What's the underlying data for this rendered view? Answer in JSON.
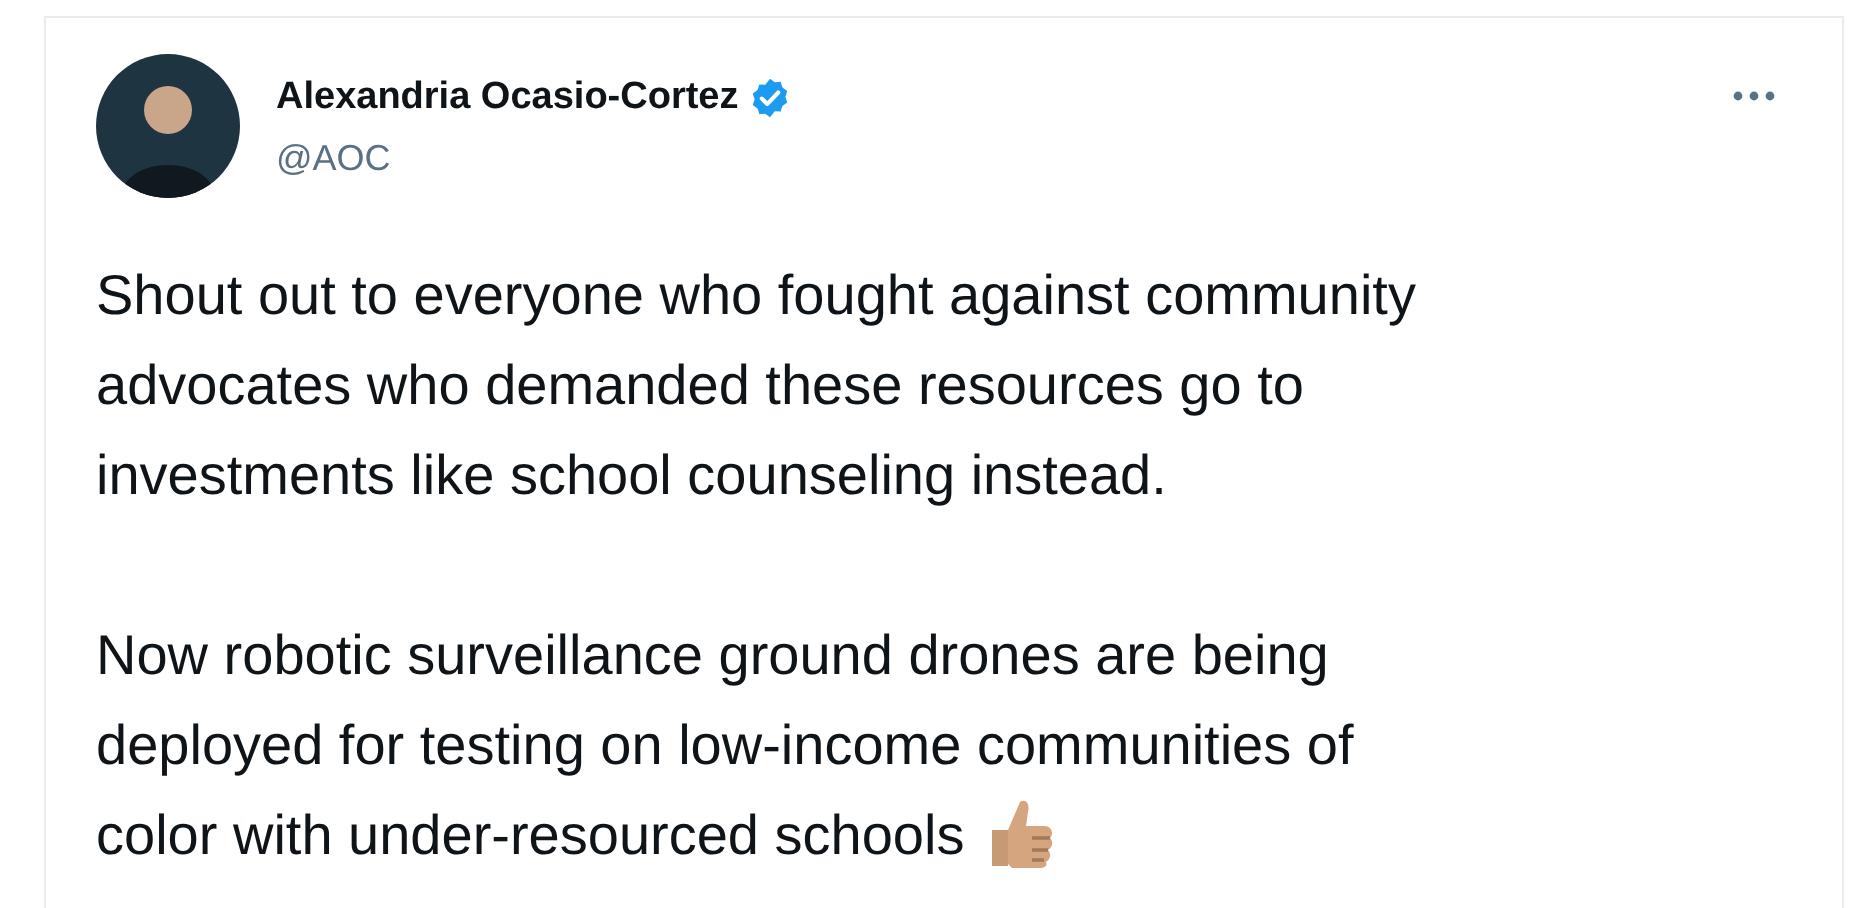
{
  "tweet": {
    "author": {
      "name": "Alexandria Ocasio-Cortez",
      "verified": true,
      "handle": "@AOC"
    },
    "paragraphs": [
      {
        "lines": [
          "Shout out to everyone who fought against community",
          "advocates who demanded these resources go to",
          "investments like school counseling instead."
        ]
      },
      {
        "lines": [
          "Now robotic surveillance ground drones are being",
          "deployed for testing on low-income communities of",
          "color with under-resourced schools"
        ],
        "thumbs_up": true
      }
    ]
  }
}
